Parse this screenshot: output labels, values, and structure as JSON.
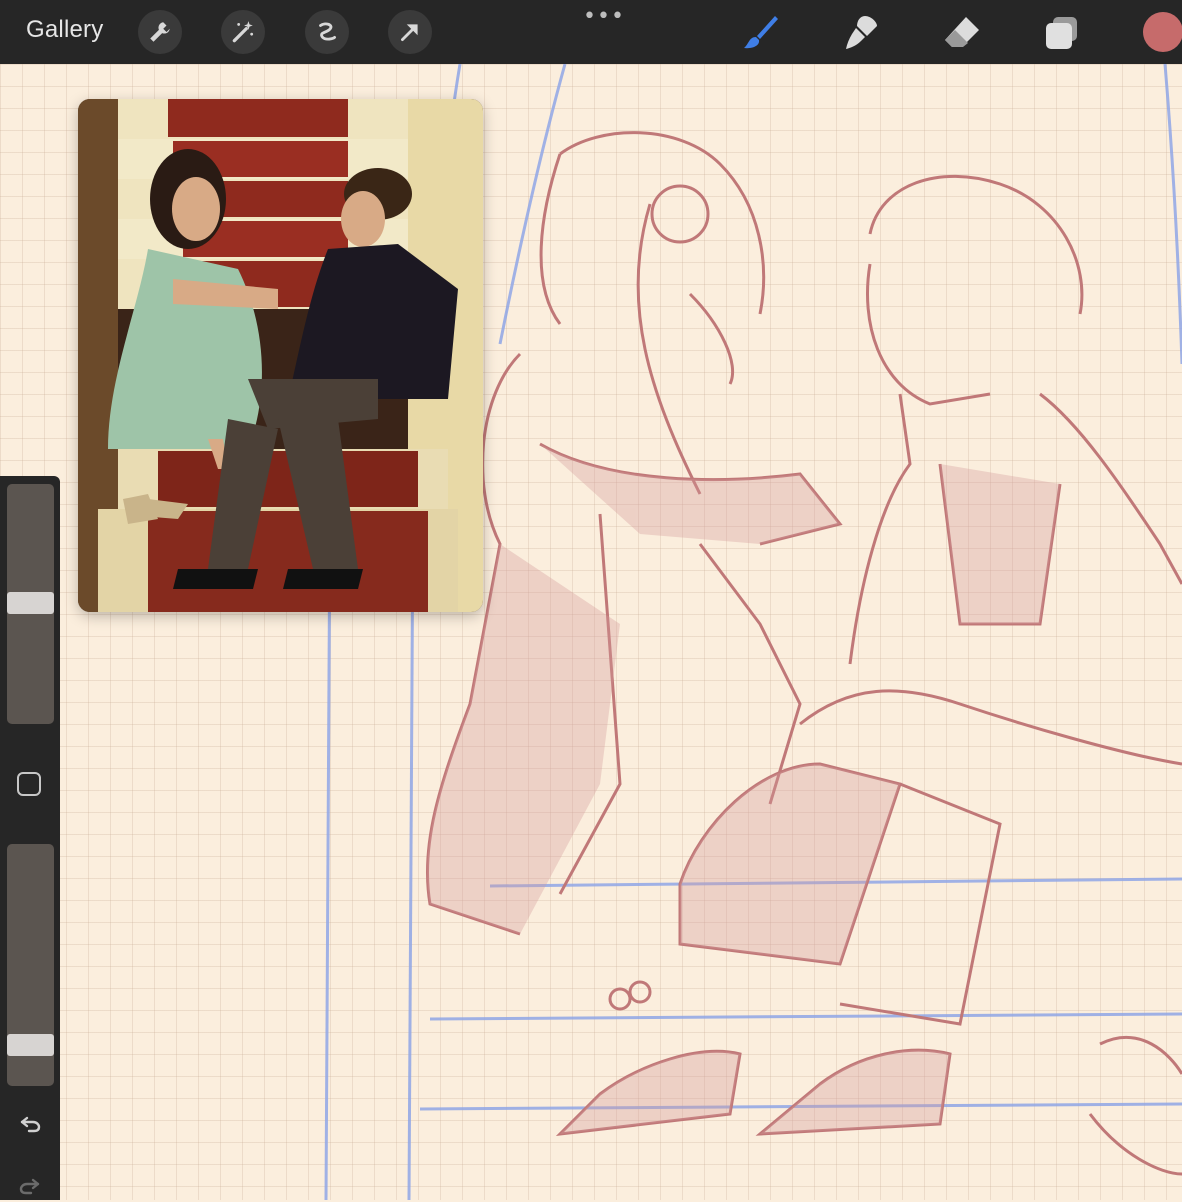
{
  "app": {
    "gallery_label": "Gallery"
  },
  "toolbar": {
    "left_tools": [
      "wrench-icon",
      "magic-wand-icon",
      "selection-icon",
      "transform-arrow-icon"
    ],
    "more_menu": "•••",
    "right_tools": [
      "brush-icon",
      "smudge-icon",
      "eraser-icon",
      "layers-icon"
    ],
    "active_tool": "brush-icon",
    "current_color": "#c66b6b",
    "accent": "#4a7fe0"
  },
  "sidebar": {
    "brush_size_level": 0.22,
    "opacity_level": 0.79,
    "modify_button": "square-icon",
    "undo": "undo-icon",
    "redo": "redo-icon"
  },
  "reference": {
    "visible": true,
    "description_icon": "reference-photo"
  },
  "canvas": {
    "sketch_color": "#c07878",
    "guide_color": "#8fa6e6",
    "paper_color": "#fbeedd"
  }
}
